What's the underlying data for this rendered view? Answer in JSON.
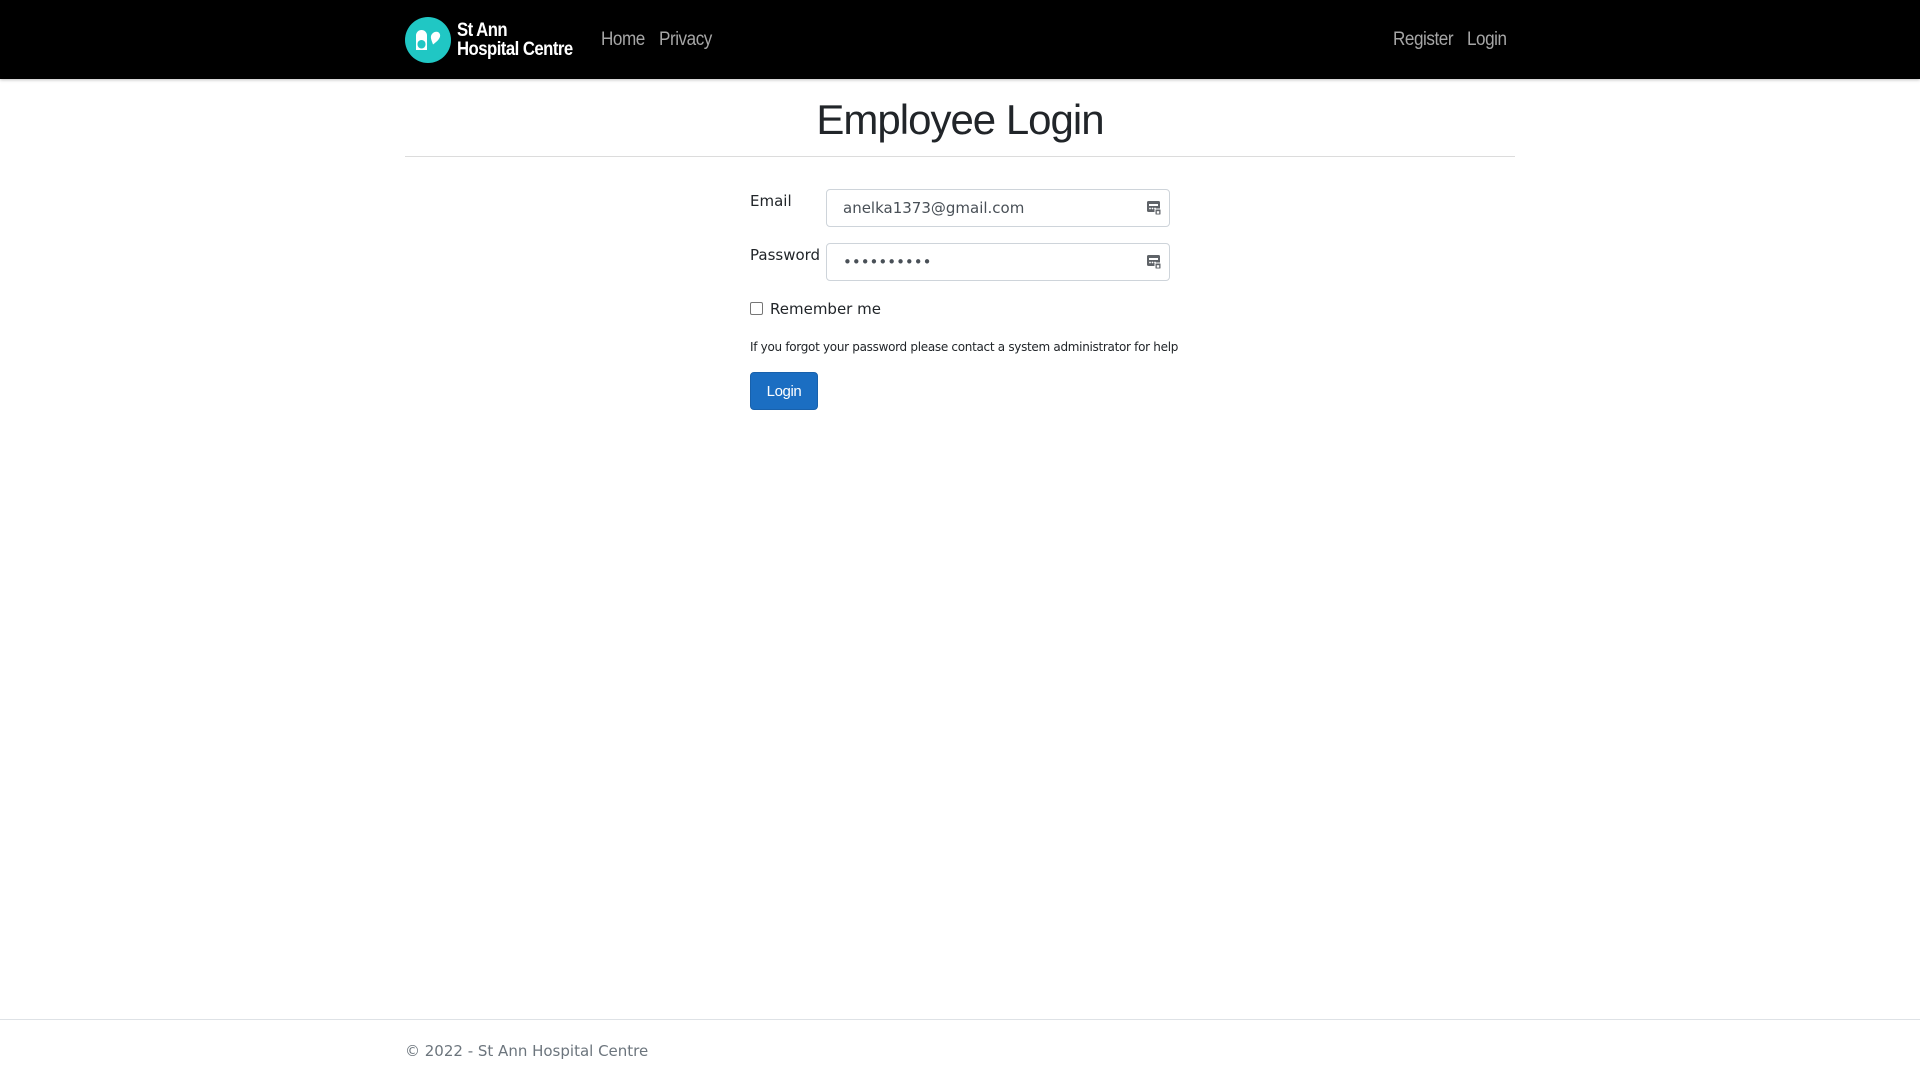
{
  "navbar": {
    "brand_line1": "St Ann",
    "brand_line2": "Hospital Centre",
    "links_left": [
      "Home",
      "Privacy"
    ],
    "links_right": [
      "Register",
      "Login"
    ],
    "logo_icon": "pill-heart-icon",
    "background_color": "#000000",
    "logo_color": "#20c7c4",
    "link_color": "#a6a6a6"
  },
  "main": {
    "title": "Employee Login",
    "email_label": "Email",
    "email_value": "anelka1373@gmail.com",
    "password_label": "Password",
    "password_value": "••••••••••",
    "field_icon": "password-manager-icon",
    "remember_label": "Remember me",
    "remember_checked": false,
    "help_text": "If you forgot your password please contact a system administrator for help",
    "login_button": "Login",
    "button_color": "#1b6ec2"
  },
  "footer": {
    "text": "© 2022 - St Ann Hospital Centre"
  }
}
